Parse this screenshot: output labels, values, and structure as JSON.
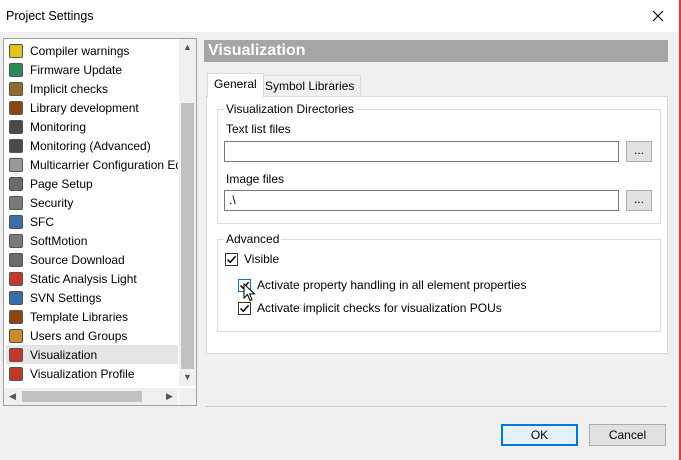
{
  "window": {
    "title": "Project Settings"
  },
  "tree": {
    "items": [
      {
        "label": "Compiler warnings",
        "icon": "warning-icon",
        "color": "#e8c21a"
      },
      {
        "label": "Firmware Update",
        "icon": "firmware-icon",
        "color": "#2e8b57"
      },
      {
        "label": "Implicit checks",
        "icon": "implicit-checks-icon",
        "color": "#8b6b2e"
      },
      {
        "label": "Library development",
        "icon": "library-icon",
        "color": "#8b4513"
      },
      {
        "label": "Monitoring",
        "icon": "monitoring-icon",
        "color": "#4a4a4a"
      },
      {
        "label": "Monitoring (Advanced)",
        "icon": "monitoring-advanced-icon",
        "color": "#4a4a4a"
      },
      {
        "label": "Multicarrier Configuration Editc",
        "icon": "multicarrier-icon",
        "color": "#9a9a9a"
      },
      {
        "label": "Page Setup",
        "icon": "printer-icon",
        "color": "#6b6b6b"
      },
      {
        "label": "Security",
        "icon": "lock-icon",
        "color": "#7a7a7a"
      },
      {
        "label": "SFC",
        "icon": "sfc-icon",
        "color": "#3a6ea5"
      },
      {
        "label": "SoftMotion",
        "icon": "softmotion-icon",
        "color": "#7a7a7a"
      },
      {
        "label": "Source Download",
        "icon": "source-download-icon",
        "color": "#6b6b6b"
      },
      {
        "label": "Static Analysis Light",
        "icon": "static-analysis-icon",
        "color": "#c0392b"
      },
      {
        "label": "SVN Settings",
        "icon": "svn-icon",
        "color": "#3a6ea5"
      },
      {
        "label": "Template Libraries",
        "icon": "template-libraries-icon",
        "color": "#8b4513"
      },
      {
        "label": "Users and Groups",
        "icon": "users-icon",
        "color": "#d08a2e"
      },
      {
        "label": "Visualization",
        "icon": "visualization-icon",
        "color": "#c0392b"
      },
      {
        "label": "Visualization Profile",
        "icon": "visualization-profile-icon",
        "color": "#c0392b"
      }
    ],
    "selected_index": 16
  },
  "main": {
    "header": "Visualization",
    "tabs": [
      {
        "label": "General"
      },
      {
        "label": "Symbol Libraries"
      }
    ],
    "directories": {
      "legend": "Visualization Directories",
      "text_list_label": "Text list files",
      "text_list_value": "",
      "image_files_label": "Image files",
      "image_files_value": ".\\",
      "browse_label": "..."
    },
    "advanced": {
      "legend": "Advanced",
      "visible_label": "Visible",
      "property_handling_label": "Activate property handling in all element properties",
      "implicit_checks_label": "Activate implicit checks for visualization POUs"
    }
  },
  "buttons": {
    "ok": "OK",
    "cancel": "Cancel"
  },
  "colors": {
    "accent": "#0078d7",
    "header_bg": "#a5a5a5"
  }
}
